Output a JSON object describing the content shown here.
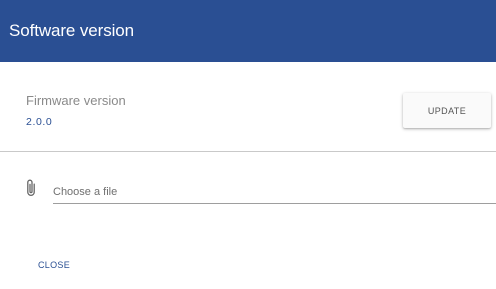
{
  "dialog": {
    "title": "Software version"
  },
  "firmware": {
    "label": "Firmware version",
    "value": "2.0.0"
  },
  "actions": {
    "update_label": "UPDATE",
    "close_label": "CLOSE"
  },
  "file_input": {
    "placeholder": "Choose a file",
    "value": "",
    "icon": "paperclip-icon"
  },
  "colors": {
    "header_bg": "#2a4f93",
    "accent": "#2a4f93",
    "label_gray": "#8a8a8a"
  }
}
